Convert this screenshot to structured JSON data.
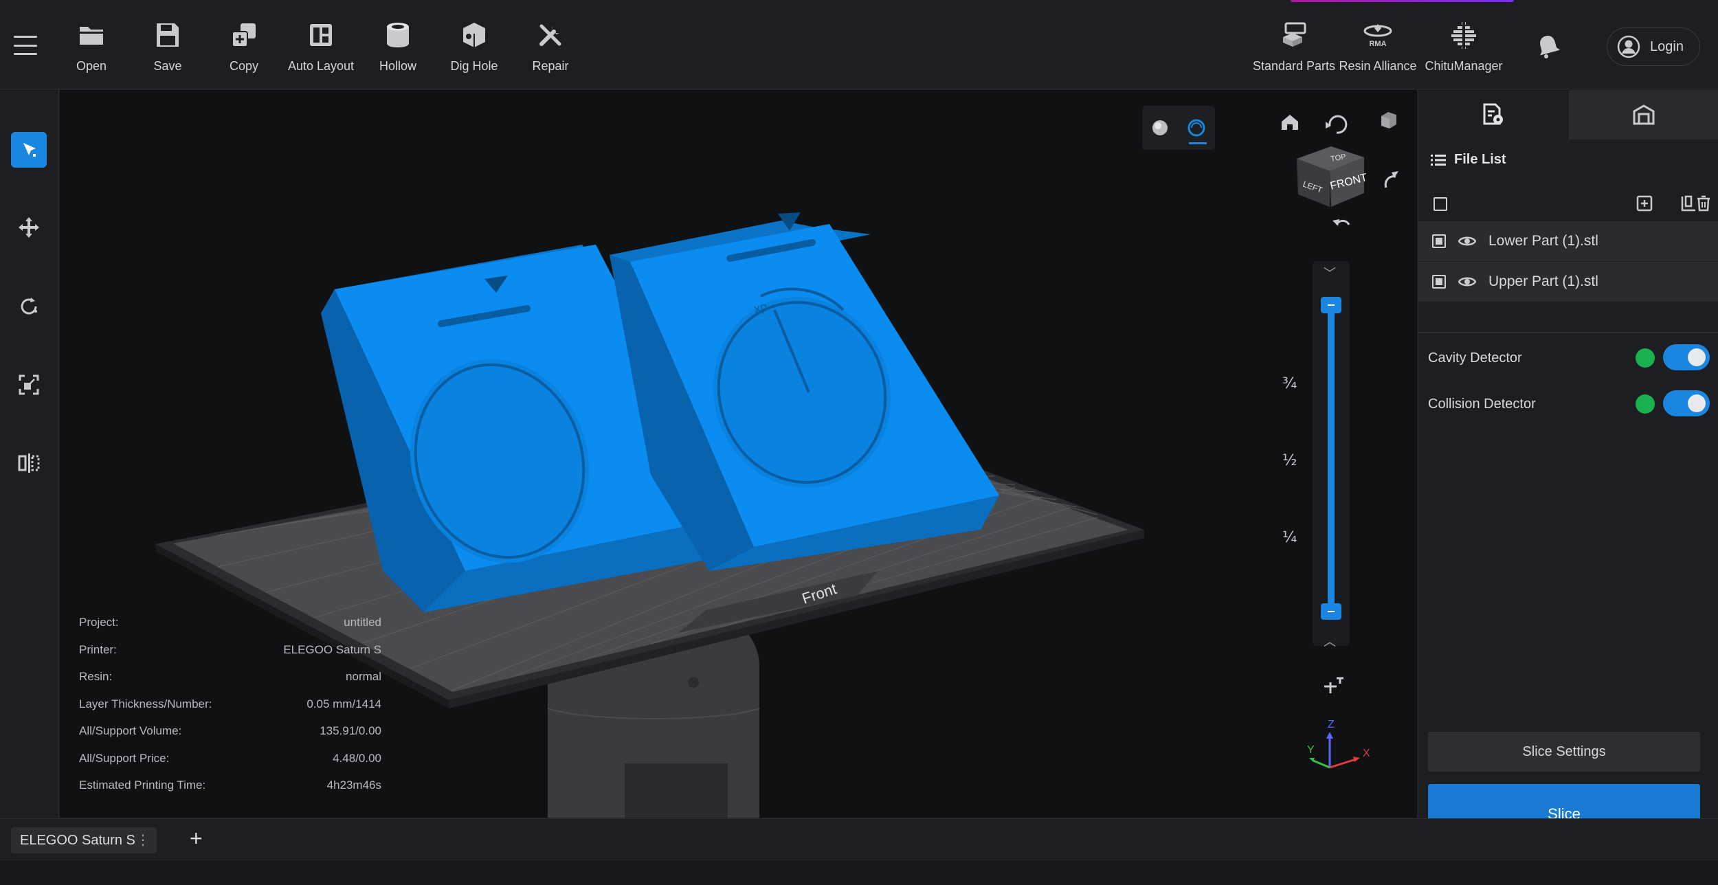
{
  "toolbar": {
    "items": [
      {
        "label": "Open",
        "icon": "folder-icon"
      },
      {
        "label": "Save",
        "icon": "save-icon"
      },
      {
        "label": "Copy",
        "icon": "copy-icon"
      },
      {
        "label": "Auto Layout",
        "icon": "auto-layout-icon"
      },
      {
        "label": "Hollow",
        "icon": "hollow-icon"
      },
      {
        "label": "Dig Hole",
        "icon": "dig-hole-icon"
      },
      {
        "label": "Repair",
        "icon": "repair-icon"
      }
    ],
    "right_items": [
      {
        "label": "Standard Parts",
        "icon": "standard-parts-icon"
      },
      {
        "label": "Resin Alliance",
        "icon": "resin-alliance-icon",
        "badge": "RMA"
      },
      {
        "label": "ChituManager",
        "icon": "chitumanager-icon"
      }
    ],
    "login_label": "Login"
  },
  "left_tools": [
    "select-tool",
    "move-tool",
    "rotate-tool",
    "scale-tool",
    "mirror-tool"
  ],
  "viewport": {
    "plate_label": "Front",
    "view_cube": {
      "top": "TOP",
      "left": "LEFT",
      "front": "FRONT"
    },
    "layer_slider": {
      "marks": [
        "¾",
        "½",
        "¼"
      ],
      "upper_fraction": 1.0,
      "lower_fraction": 0.0
    },
    "axes": {
      "x": "X",
      "y": "Y",
      "z": "Z"
    },
    "colors": {
      "model": "#0b8cf0",
      "accent": "#1a86e0",
      "x_axis": "#e23b3b",
      "y_axis": "#33c24a",
      "z_axis": "#5a66ff"
    }
  },
  "info": {
    "rows": [
      {
        "key": "Project:",
        "value": "untitled"
      },
      {
        "key": "Printer:",
        "value": "ELEGOO Saturn S"
      },
      {
        "key": "Resin:",
        "value": "normal"
      },
      {
        "key": "Layer Thickness/Number:",
        "value": "0.05 mm/1414"
      },
      {
        "key": "All/Support Volume:",
        "value": "135.91/0.00"
      },
      {
        "key": "All/Support Price:",
        "value": "4.48/0.00"
      },
      {
        "key": "Estimated Printing Time:",
        "value": "4h23m46s"
      }
    ]
  },
  "panel": {
    "file_list_title": "File List",
    "files": [
      {
        "name": "Lower Part (1).stl"
      },
      {
        "name": "Upper Part (1).stl"
      }
    ],
    "detectors": [
      {
        "label": "Cavity Detector",
        "enabled": true
      },
      {
        "label": "Collision Detector",
        "enabled": true
      }
    ],
    "slice_settings_label": "Slice Settings",
    "slice_label": "Slice"
  },
  "bottom": {
    "tab_label": "ELEGOO Saturn S",
    "tab_menu": "⋮",
    "add_label": "+"
  }
}
